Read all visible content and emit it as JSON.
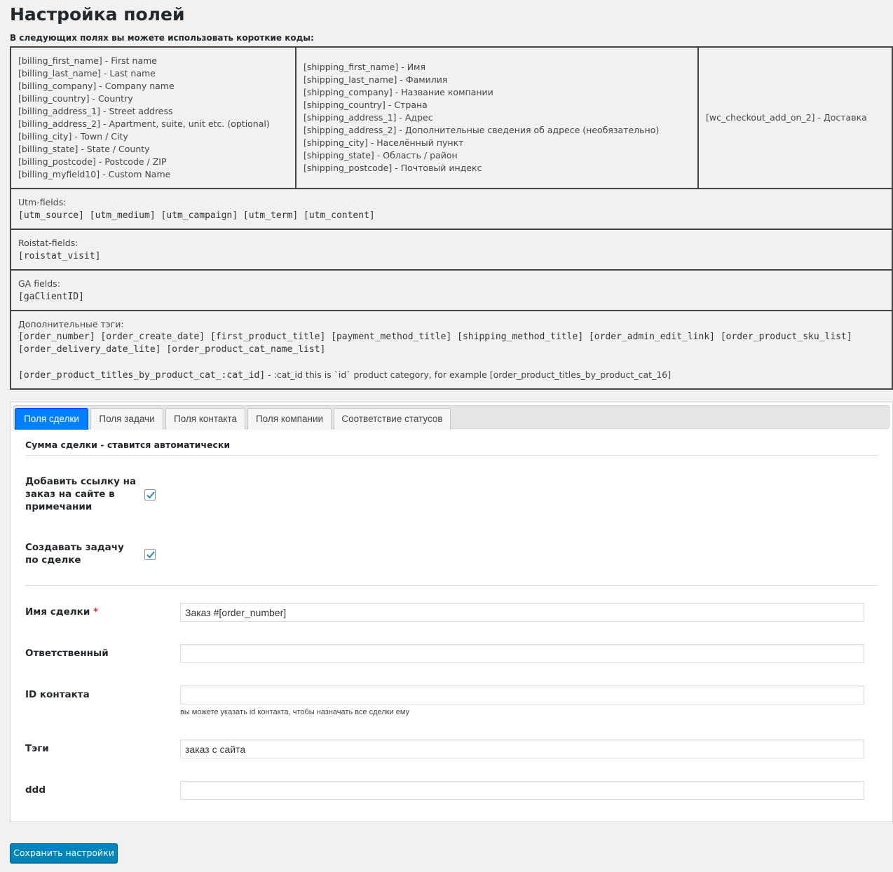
{
  "page": {
    "title": "Настройка полей",
    "intro": "В следующих полях вы можете использовать короткие коды:"
  },
  "codes": {
    "billing": [
      "[billing_first_name] - First name",
      "[billing_last_name] - Last name",
      "[billing_company] - Company name",
      "[billing_country] - Country",
      "[billing_address_1] - Street address",
      "[billing_address_2] - Apartment, suite, unit etc. (optional)",
      "[billing_city] - Town / City",
      "[billing_state] - State / County",
      "[billing_postcode] - Postcode / ZIP",
      "[billing_myfield10] - Custom Name"
    ],
    "shipping": [
      "[shipping_first_name] - Имя",
      "[shipping_last_name] - Фамилия",
      "[shipping_company] - Название компании",
      "[shipping_country] - Страна",
      "[shipping_address_1] - Адрес",
      "[shipping_address_2] - Дополнительные сведения об адресе (необязательно)",
      "[shipping_city] - Населённый пункт",
      "[shipping_state] - Область / район",
      "[shipping_postcode] - Почтовый индекс"
    ],
    "addon": "[wc_checkout_add_on_2] - Доставка",
    "utm": {
      "label": "Utm-fields:",
      "codes": "[utm_source] [utm_medium] [utm_campaign] [utm_term] [utm_content]"
    },
    "roistat": {
      "label": "Roistat-fields:",
      "codes": "[roistat_visit]"
    },
    "ga": {
      "label": "GA fields:",
      "codes": "[gaClientID]"
    },
    "extra": {
      "label": "Дополнительные тэги:",
      "line1": "[order_number] [order_create_date] [first_product_title] [payment_method_title] [shipping_method_title] [order_admin_edit_link] [order_product_sku_list]",
      "line2": "[order_delivery_date_lite] [order_product_cat_name_list]",
      "cat_code": "[order_product_titles_by_product_cat_:cat_id]",
      "cat_desc": " - :cat_id this is `id` product category, for example [order_product_titles_by_product_cat_16]"
    }
  },
  "tabs": [
    "Поля сделки",
    "Поля задачи",
    "Поля контакта",
    "Поля компании",
    "Соответствие статусов"
  ],
  "deal": {
    "section_title": "Сумма сделки - ставится автоматически",
    "add_link": {
      "label": "Добавить ссылку на заказ на сайте в примечании",
      "checked": true
    },
    "create_task": {
      "label": "Создавать задачу по сделке",
      "checked": true
    },
    "name": {
      "label": "Имя сделки",
      "required_mark": "*",
      "value": "Заказ #[order_number]"
    },
    "responsible": {
      "label": "Ответственный",
      "value": ""
    },
    "contact_id": {
      "label": "ID контакта",
      "value": "",
      "hint": "вы можете указать id контакта, чтобы назначать все сделки ему"
    },
    "tags": {
      "label": "Тэги",
      "value": "заказ с сайта"
    },
    "ddd": {
      "label": "ddd",
      "value": ""
    }
  },
  "save_label": "Сохранить настройки",
  "colors": {
    "tab_active": "#007fff",
    "button": "#0085ba",
    "required": "#d63638",
    "check": "#1e8cbe"
  }
}
